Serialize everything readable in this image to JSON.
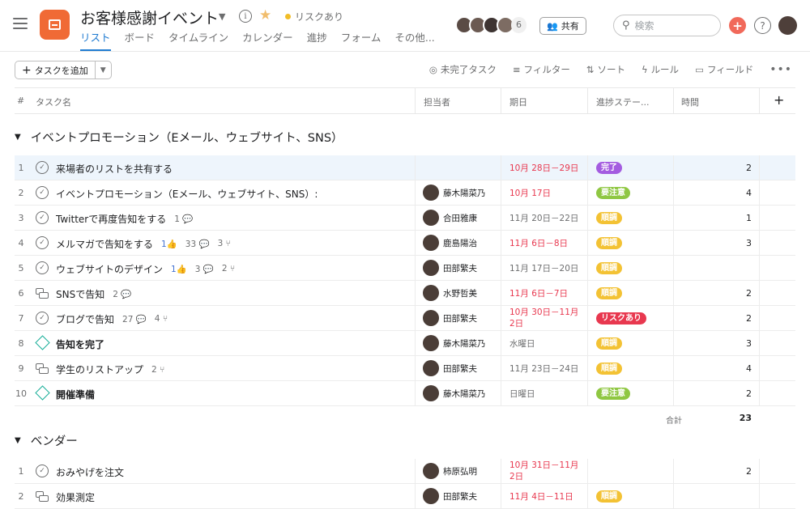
{
  "project": {
    "title": "お客様感謝イベント",
    "status": "リスクあり",
    "tabs": [
      "リスト",
      "ボード",
      "タイムライン",
      "カレンダー",
      "進捗",
      "フォーム",
      "その他..."
    ],
    "member_count": "6",
    "share_label": "共有",
    "search_placeholder": "検索"
  },
  "toolbar": {
    "add_task": "タスクを追加",
    "incomplete": "未完了タスク",
    "filter": "フィルター",
    "sort": "ソート",
    "rules": "ルール",
    "fields": "フィールド"
  },
  "columns": {
    "num": "#",
    "task": "タスク名",
    "assignee": "担当者",
    "due": "期日",
    "status": "進捗ステー...",
    "time": "時間"
  },
  "colors": {
    "完了": "#a45ce0",
    "要注意": "#8fc742",
    "順調": "#f3c234",
    "リスクあり": "#e8384f"
  },
  "sections": [
    {
      "title": "イベントプロモーション（Eメール、ウェブサイト、SNS）",
      "total_label": "合計",
      "total": "23",
      "rows": [
        {
          "n": "1",
          "type": "check",
          "name": "来場者のリストを共有する",
          "meta": [],
          "assignee": "",
          "date": "10月 28日－29日",
          "red": true,
          "status": "完了",
          "time": "2"
        },
        {
          "n": "2",
          "type": "check",
          "name": "イベントプロモーション（Eメール、ウェブサイト、SNS）:",
          "meta": [],
          "assignee": "藤木陽菜乃",
          "date": "10月 17日",
          "red": true,
          "status": "要注意",
          "time": "4"
        },
        {
          "n": "3",
          "type": "check",
          "name": "Twitterで再度告知をする",
          "meta": [
            "1 💬"
          ],
          "assignee": "合田雅康",
          "date": "11月 20日－22日",
          "red": false,
          "status": "順調",
          "time": "1"
        },
        {
          "n": "4",
          "type": "check",
          "name": "メルマガで告知をする",
          "meta": [
            "1👍",
            "33 💬",
            "3 ⑂"
          ],
          "assignee": "鹿島陽治",
          "date": "11月 6日－8日",
          "red": true,
          "status": "順調",
          "time": "3"
        },
        {
          "n": "5",
          "type": "check",
          "name": "ウェブサイトのデザイン",
          "meta": [
            "1👍",
            "3 💬",
            "2 ⑂"
          ],
          "assignee": "田部繁夫",
          "date": "11月 17日－20日",
          "red": false,
          "status": "順調",
          "time": ""
        },
        {
          "n": "6",
          "type": "sub",
          "name": "SNSで告知",
          "meta": [
            "2 💬"
          ],
          "assignee": "水野哲美",
          "date": "11月 6日－7日",
          "red": true,
          "status": "順調",
          "time": "2"
        },
        {
          "n": "7",
          "type": "check",
          "name": "ブログで告知",
          "meta": [
            "27 💬",
            "4 ⑂"
          ],
          "assignee": "田部繁夫",
          "date": "10月 30日－11月 2日",
          "red": true,
          "status": "リスクあり",
          "time": "2"
        },
        {
          "n": "8",
          "type": "mile",
          "name": "告知を完了",
          "meta": [],
          "assignee": "藤木陽菜乃",
          "date": "水曜日",
          "red": false,
          "status": "順調",
          "time": "3"
        },
        {
          "n": "9",
          "type": "sub",
          "name": "学生のリストアップ",
          "meta": [
            "2 ⑂"
          ],
          "assignee": "田部繁夫",
          "date": "11月 23日－24日",
          "red": false,
          "status": "順調",
          "time": "4"
        },
        {
          "n": "10",
          "type": "mile",
          "name": "開催準備",
          "meta": [],
          "assignee": "藤木陽菜乃",
          "date": "日曜日",
          "red": false,
          "status": "要注意",
          "time": "2"
        }
      ]
    },
    {
      "title": "ベンダー",
      "rows": [
        {
          "n": "1",
          "type": "check",
          "name": "おみやげを注文",
          "meta": [],
          "assignee": "柿原弘明",
          "date": "10月 31日－11月 2日",
          "red": true,
          "status": "",
          "time": "2"
        },
        {
          "n": "2",
          "type": "sub",
          "name": "効果測定",
          "meta": [],
          "assignee": "田部繁夫",
          "date": "11月 4日－11日",
          "red": true,
          "status": "順調",
          "time": ""
        }
      ]
    }
  ]
}
